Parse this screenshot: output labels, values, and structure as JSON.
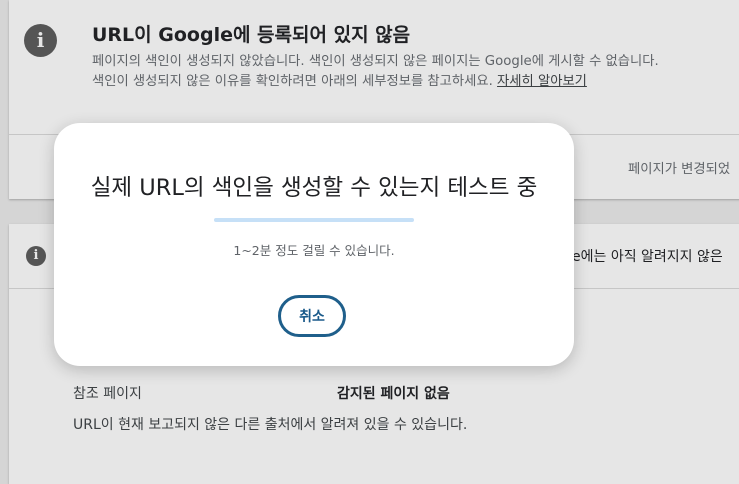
{
  "top_card": {
    "title": "URL이 Google에 등록되어 있지 않음",
    "description": "페이지의 색인이 생성되지 않았습니다. 색인이 생성되지 않은 페이지는 Google에 게시할 수 없습니다. 색인이 생성되지 않은 이유를 확인하려면 아래의 세부정보를 참고하세요. ",
    "learn_more_link": "자세히 알아보기",
    "right_text": "페이지가 변경되었"
  },
  "mid_card": {
    "right_text": "e에는 아직 알려지지 않은",
    "referring_label": "참조 페이지",
    "referring_value": "감지된 페이지 없음",
    "note": "URL이 현재 보고되지 않은 다른 출처에서 알려져 있을 수 있습니다."
  },
  "dialog": {
    "title": "실제 URL의 색인을 생성할 수 있는지 테스트 중",
    "subtitle": "1~2분 정도 걸릴 수 있습니다.",
    "cancel_label": "취소",
    "progress_percent": 0
  },
  "colors": {
    "accent": "#1a73e8",
    "progress_track": "#c6e0f7",
    "button_border": "#1f5f8b"
  },
  "icons": {
    "info": "info-icon"
  }
}
